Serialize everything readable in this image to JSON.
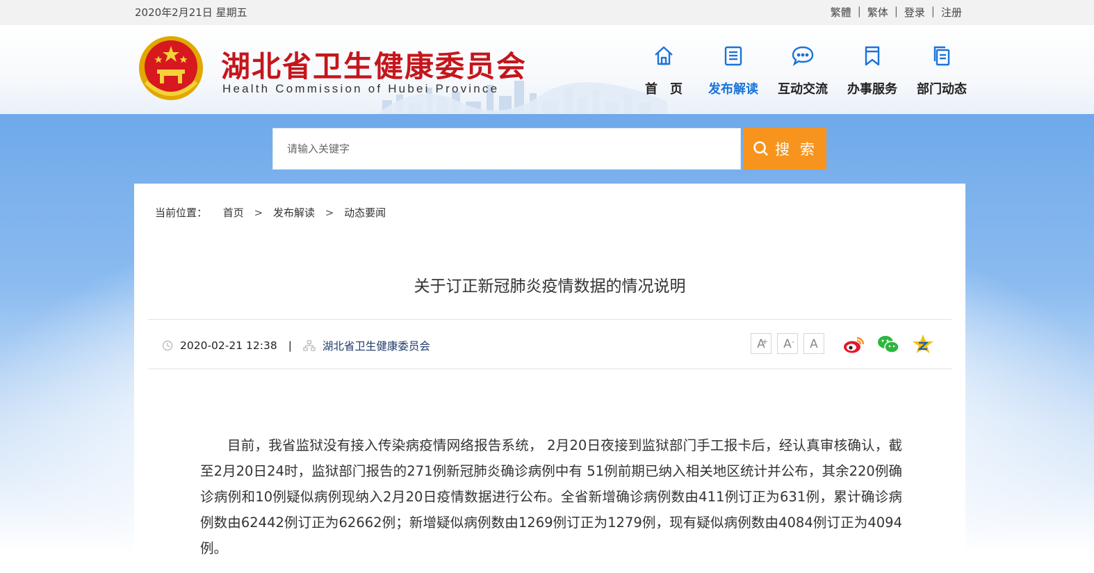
{
  "topbar": {
    "date": "2020年2月21日 星期五",
    "links": [
      "繁體",
      "繁体",
      "登录",
      "注册"
    ],
    "separator": "|"
  },
  "header": {
    "title": "湖北省卫生健康委员会",
    "subtitle": "Health Commission of Hubei Province",
    "brand_color": "#c4161c",
    "nav": [
      {
        "label": "首　页",
        "icon": "home-icon"
      },
      {
        "label": "发布解读",
        "icon": "document-icon",
        "active": true
      },
      {
        "label": "互动交流",
        "icon": "chat-icon"
      },
      {
        "label": "办事服务",
        "icon": "bookmark-icon"
      },
      {
        "label": "部门动态",
        "icon": "copy-icon"
      }
    ]
  },
  "search": {
    "placeholder": "请输入关键字",
    "button_label": "搜 索",
    "button_color": "#f7941d"
  },
  "breadcrumb": {
    "prefix": "当前位置：",
    "items": [
      "首页",
      "发布解读",
      "动态要闻"
    ],
    "separator": ">"
  },
  "article": {
    "title": "关于订正新冠肺炎疫情数据的情况说明",
    "datetime": "2020-02-21 12:38",
    "meta_separator": "|",
    "source": "湖北省卫生健康委员会",
    "font_buttons": [
      "A",
      "A",
      "A"
    ],
    "share": [
      "weibo-icon",
      "wechat-icon",
      "qzone-icon"
    ],
    "body": "目前，我省监狱没有接入传染病疫情网络报告系统， 2月20日夜接到监狱部门手工报卡后，经认真审核确认，截至2月20日24时，监狱部门报告的271例新冠肺炎确诊病例中有 51例前期已纳入相关地区统计并公布，其余220例确诊病例和10例疑似病例现纳入2月20日疫情数据进行公布。全省新增确诊病例数由411例订正为631例，累计确诊病例数由62442例订正为62662例；新增疑似病例数由1269例订正为1279例，现有疑似病例数由4084例订正为4094例。"
  },
  "colors": {
    "link_active": "#1a73d9",
    "band_blue": "#6fa9ea"
  }
}
